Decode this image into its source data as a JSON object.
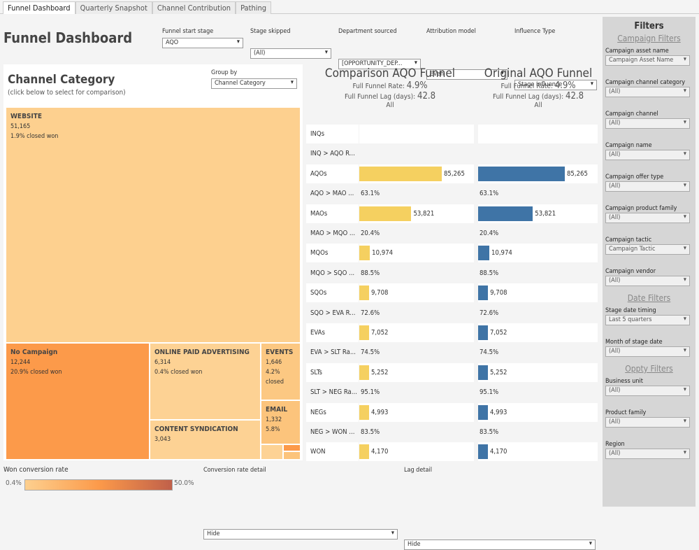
{
  "tabs": [
    "Funnel Dashboard",
    "Quarterly Snapshot",
    "Channel Contribution",
    "Pathing"
  ],
  "title": "Funnel Dashboard",
  "top_filters": [
    {
      "label": "Funnel start stage",
      "value": "AQO"
    },
    {
      "label": "Stage skipped",
      "value": "(All)"
    },
    {
      "label": "Department sourced",
      "value": "[OPPORTUNITY_DEP..."
    },
    {
      "label": "Attribution model",
      "value": "Even"
    },
    {
      "label": "Influence Type",
      "value": "Stage Influence"
    }
  ],
  "treemap": {
    "title": "Channel Category",
    "subtitle": "(click below to select for comparison)",
    "group_by_label": "Group by",
    "group_by_value": "Channel Category",
    "cells": [
      {
        "name": "WEBSITE",
        "count": "51,165",
        "rate": "1.9% closed won",
        "color": "#fdd08f"
      },
      {
        "name": "No Campaign",
        "count": "12,244",
        "rate": "20.9% closed won",
        "color": "#fc9a4a"
      },
      {
        "name": "ONLINE PAID ADVERTISING",
        "count": "6,314",
        "rate": "0.4% closed won",
        "color": "#fdd294"
      },
      {
        "name": "CONTENT SYNDICATION",
        "count": "3,043",
        "rate": "",
        "color": "#fdd294"
      },
      {
        "name": "EVENTS",
        "count": "1,646",
        "rate": "4.2%",
        "rate2": "closed",
        "color": "#fcc882"
      },
      {
        "name": "EMAIL",
        "count": "1,332",
        "rate": "5.8%",
        "color": "#fcc47c"
      }
    ]
  },
  "legend": {
    "label": "Won conversion rate",
    "min": "0.4%",
    "max": "50.0%",
    "colors": [
      "#fdd08f",
      "#fc9a4a",
      "#c0604a"
    ]
  },
  "conv_detail": {
    "label": "Conversion rate detail",
    "value": "Hide"
  },
  "lag_detail": {
    "label": "Lag detail",
    "value": "Hide"
  },
  "comparison": {
    "title": "Comparison AQO Funnel",
    "rate_label": "Full Funnel Rate:",
    "rate": "4.9%",
    "lag_label": "Full Funnel Lag (days):",
    "lag": "42.8",
    "scope": "All",
    "color": "#f5d060"
  },
  "original": {
    "title": "Original AQO Funnel",
    "rate_label": "Full Funnel Rate:",
    "rate": "4.9%",
    "lag_label": "Full Funnel Lag (days):",
    "lag": "42.8",
    "scope": "All",
    "color": "#3f74a6"
  },
  "funnel_max": 85265,
  "funnel": [
    {
      "label": "INQs",
      "type": "stage"
    },
    {
      "label": "INQ > AQO R...",
      "type": "rate"
    },
    {
      "label": "AQOs",
      "type": "stage",
      "value": 85265,
      "text": "85,265"
    },
    {
      "label": "AQO > MAO ...",
      "type": "rate",
      "text": "63.1%"
    },
    {
      "label": "MAOs",
      "type": "stage",
      "value": 53821,
      "text": "53,821"
    },
    {
      "label": "MAO > MQO ...",
      "type": "rate",
      "text": "20.4%"
    },
    {
      "label": "MQOs",
      "type": "stage",
      "value": 10974,
      "text": "10,974"
    },
    {
      "label": "MQO > SQO ...",
      "type": "rate",
      "text": "88.5%"
    },
    {
      "label": "SQOs",
      "type": "stage",
      "value": 9708,
      "text": "9,708"
    },
    {
      "label": "SQO > EVA R...",
      "type": "rate",
      "text": "72.6%"
    },
    {
      "label": "EVAs",
      "type": "stage",
      "value": 7052,
      "text": "7,052"
    },
    {
      "label": "EVA > SLT Ra...",
      "type": "rate",
      "text": "74.5%"
    },
    {
      "label": "SLTs",
      "type": "stage",
      "value": 5252,
      "text": "5,252"
    },
    {
      "label": "SLT > NEG Ra...",
      "type": "rate",
      "text": "95.1%"
    },
    {
      "label": "NEGs",
      "type": "stage",
      "value": 4993,
      "text": "4,993"
    },
    {
      "label": "NEG > WON ...",
      "type": "rate",
      "text": "83.5%"
    },
    {
      "label": "WON",
      "type": "stage",
      "value": 4170,
      "text": "4,170"
    }
  ],
  "filters": {
    "title": "Filters",
    "sections": [
      {
        "title": "Campaign Filters",
        "items": [
          {
            "label": "Campaign asset name",
            "value": "Campaign Asset Name"
          },
          {
            "label": "Campaign channel category",
            "value": "(All)"
          },
          {
            "label": "Campaign channel",
            "value": "(All)"
          },
          {
            "label": "Campaign name",
            "value": "(All)"
          },
          {
            "label": "Campaign offer type",
            "value": "(All)"
          },
          {
            "label": "Campaign product family",
            "value": "(All)"
          },
          {
            "label": "Campaign tactic",
            "value": "Campaign Tactic"
          },
          {
            "label": "Campaign vendor",
            "value": "(All)"
          }
        ]
      },
      {
        "title": "Date Filters",
        "items": [
          {
            "label": "Stage date timing",
            "value": "Last 5 quarters"
          },
          {
            "label": "Month of stage date",
            "value": "(All)"
          }
        ]
      },
      {
        "title": "Oppty Filters",
        "items": [
          {
            "label": "Business unit",
            "value": "(All)"
          },
          {
            "label": "Product family",
            "value": "(All)"
          },
          {
            "label": "Region",
            "value": "(All)"
          }
        ]
      }
    ]
  }
}
